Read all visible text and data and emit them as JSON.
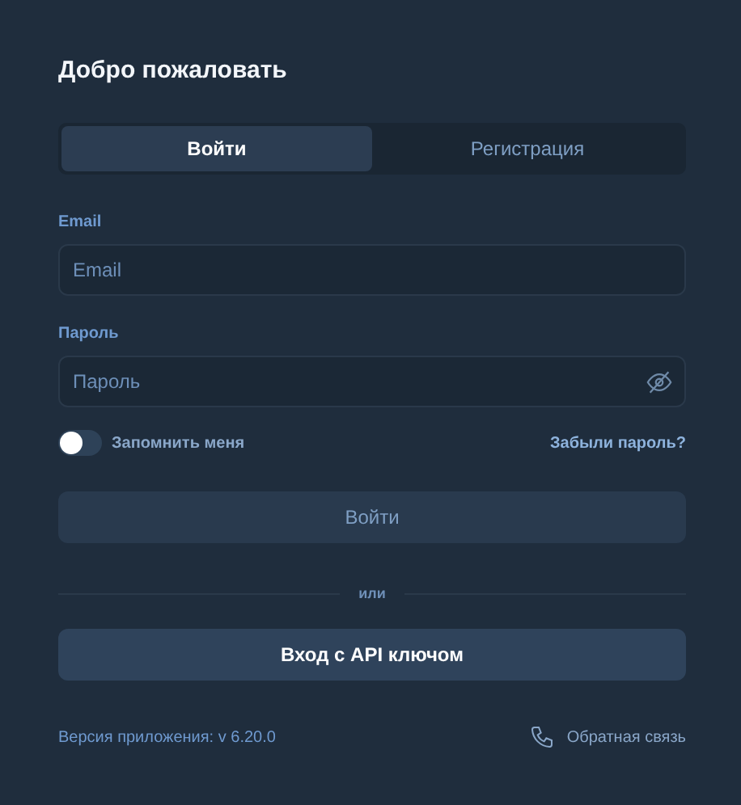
{
  "title": "Добро пожаловать",
  "tabs": [
    {
      "label": "Войти",
      "selected": true
    },
    {
      "label": "Регистрация",
      "selected": false
    }
  ],
  "email": {
    "label": "Email",
    "placeholder": "Email"
  },
  "password": {
    "label": "Пароль",
    "placeholder": "Пароль"
  },
  "remember": {
    "label": "Запомнить меня",
    "on": false
  },
  "forgot_link": "Забыли пароль?",
  "login_button": {
    "label": "Войти",
    "disabled": true
  },
  "divider": "или",
  "api_button": "Вход с API ключом",
  "footer": {
    "version": "Версия приложения: v 6.20.0",
    "feedback": "Обратная связь"
  }
}
